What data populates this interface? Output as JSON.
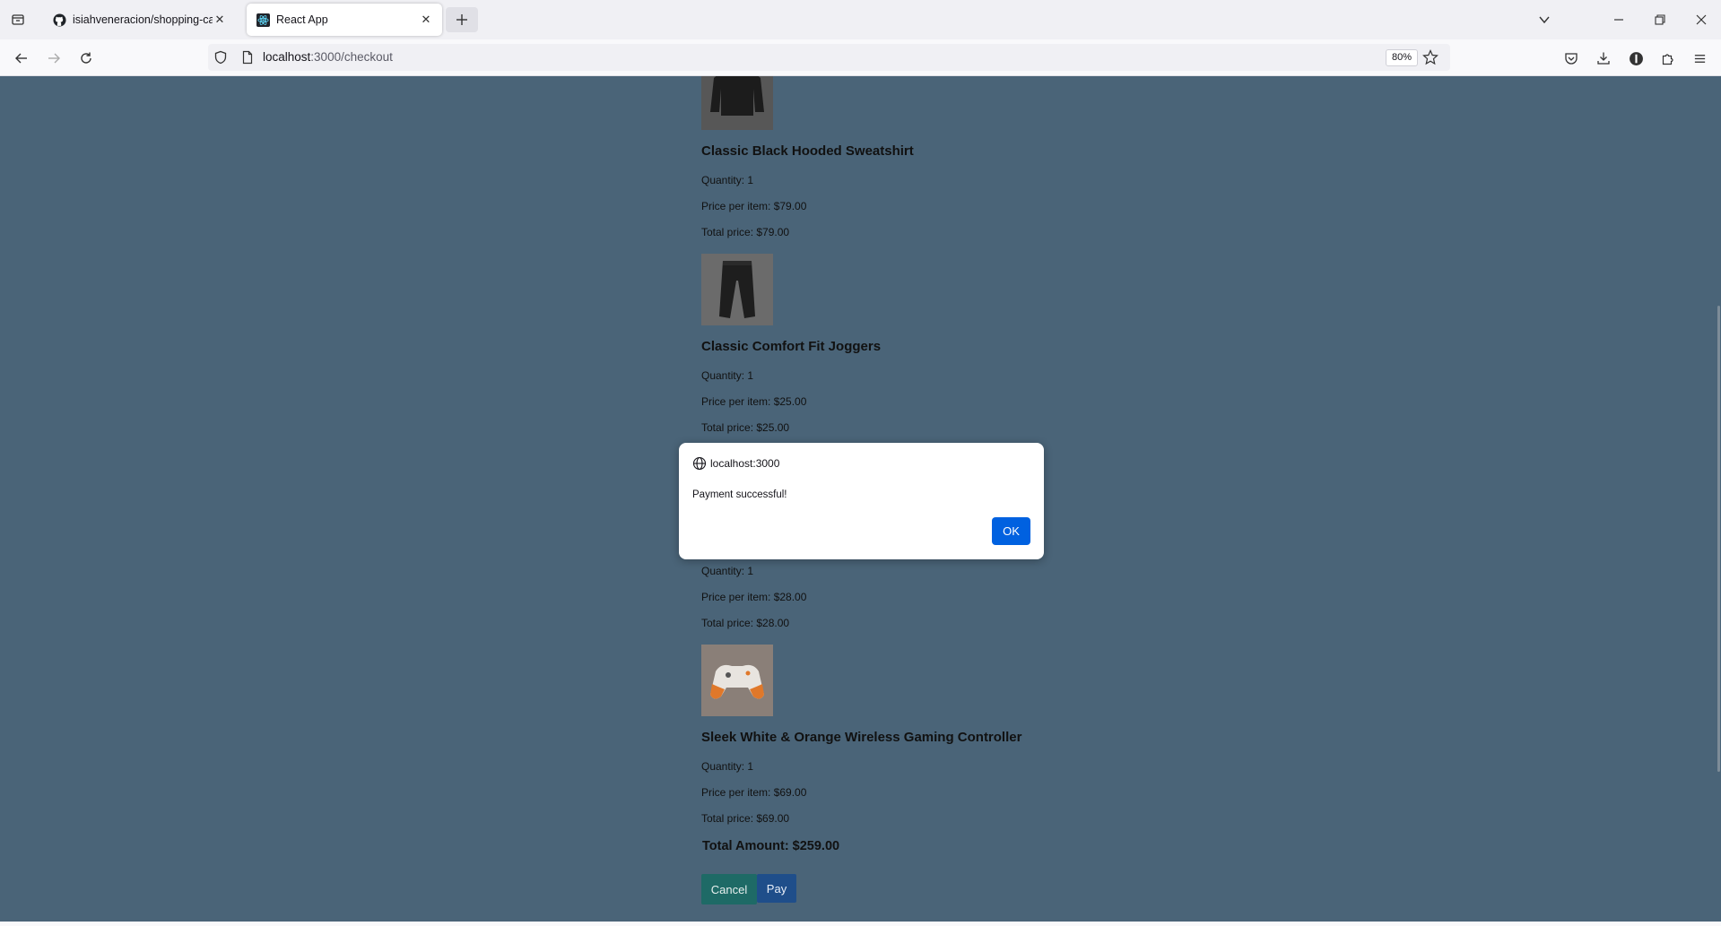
{
  "browser": {
    "tabs": [
      {
        "title": "isiahveneracion/shopping-cart",
        "icon": "github-icon",
        "active": false
      },
      {
        "title": "React App",
        "icon": "react-icon",
        "active": true
      }
    ],
    "url_host": "localhost",
    "url_path": ":3000/checkout",
    "zoom": "80%"
  },
  "checkout": {
    "items": [
      {
        "name": "Classic Black Hooded Sweatshirt",
        "quantity": "Quantity: 1",
        "price_per_item": "Price per item: $79.00",
        "total_price": "Total price: $79.00",
        "image": "black-hoodie-image"
      },
      {
        "name": "Classic Comfort Fit Joggers",
        "quantity": "Quantity: 1",
        "price_per_item": "Price per item: $25.00",
        "total_price": "Total price: $25.00",
        "image": "joggers-image"
      },
      {
        "name": "",
        "quantity": "Quantity: 1",
        "price_per_item": "Price per item: $28.00",
        "total_price": "Total price: $28.00",
        "image": ""
      },
      {
        "name": "Sleek White & Orange Wireless Gaming Controller",
        "quantity": "Quantity: 1",
        "price_per_item": "Price per item: $69.00",
        "total_price": "Total price: $69.00",
        "image": "gaming-controller-image"
      }
    ],
    "total_amount": "Total Amount: $259.00",
    "cancel_label": "Cancel",
    "pay_label": "Pay"
  },
  "dialog": {
    "origin": "localhost:3000",
    "message": "Payment successful!",
    "ok_label": "OK"
  },
  "colors": {
    "page_background": "#4a6478",
    "cancel_button": "#1e6a66",
    "pay_button": "#1f4e8a",
    "dialog_ok_button": "#0061e0"
  }
}
